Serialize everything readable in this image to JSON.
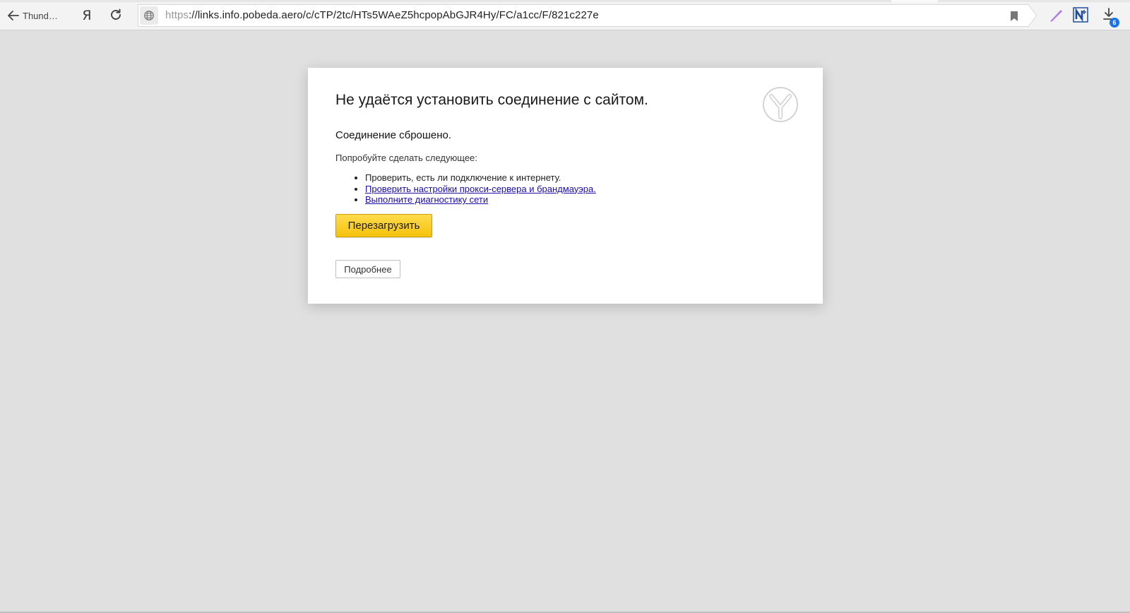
{
  "toolbar": {
    "back_label": "Thund…",
    "yandex_label": "Я",
    "url_scheme": "https",
    "url_rest": "://links.info.pobeda.aero/c/cTP/2tc/HTs5WAeZ5hcpopAbGJR4Hy/FC/a1cc/F/821c227e",
    "downloads_count": "6",
    "icons": {
      "back": "arrow-left-icon",
      "reload": "reload-icon",
      "site_info": "globe-icon",
      "bookmark": "bookmark-icon",
      "pen": "pen-icon",
      "notes": "notes-icon",
      "downloads": "download-icon"
    }
  },
  "error": {
    "title": "Не удаётся установить соединение с сайтом.",
    "subtitle": "Соединение сброшено.",
    "intro": "Попробуйте сделать следующее:",
    "suggestions": [
      "Проверить, есть ли подключение к интернету.",
      "Проверить настройки прокси-сервера и брандмауэра.",
      "Выполните диагностику сети"
    ],
    "reload_label": "Перезагрузить",
    "details_label": "Подробнее",
    "logo": "yandex-browser-logo-icon"
  },
  "colors": {
    "page_background": "#e0e0e0",
    "reload_button": "#f5c20b",
    "link": "#1a0dab",
    "badge": "#1a73e8"
  }
}
